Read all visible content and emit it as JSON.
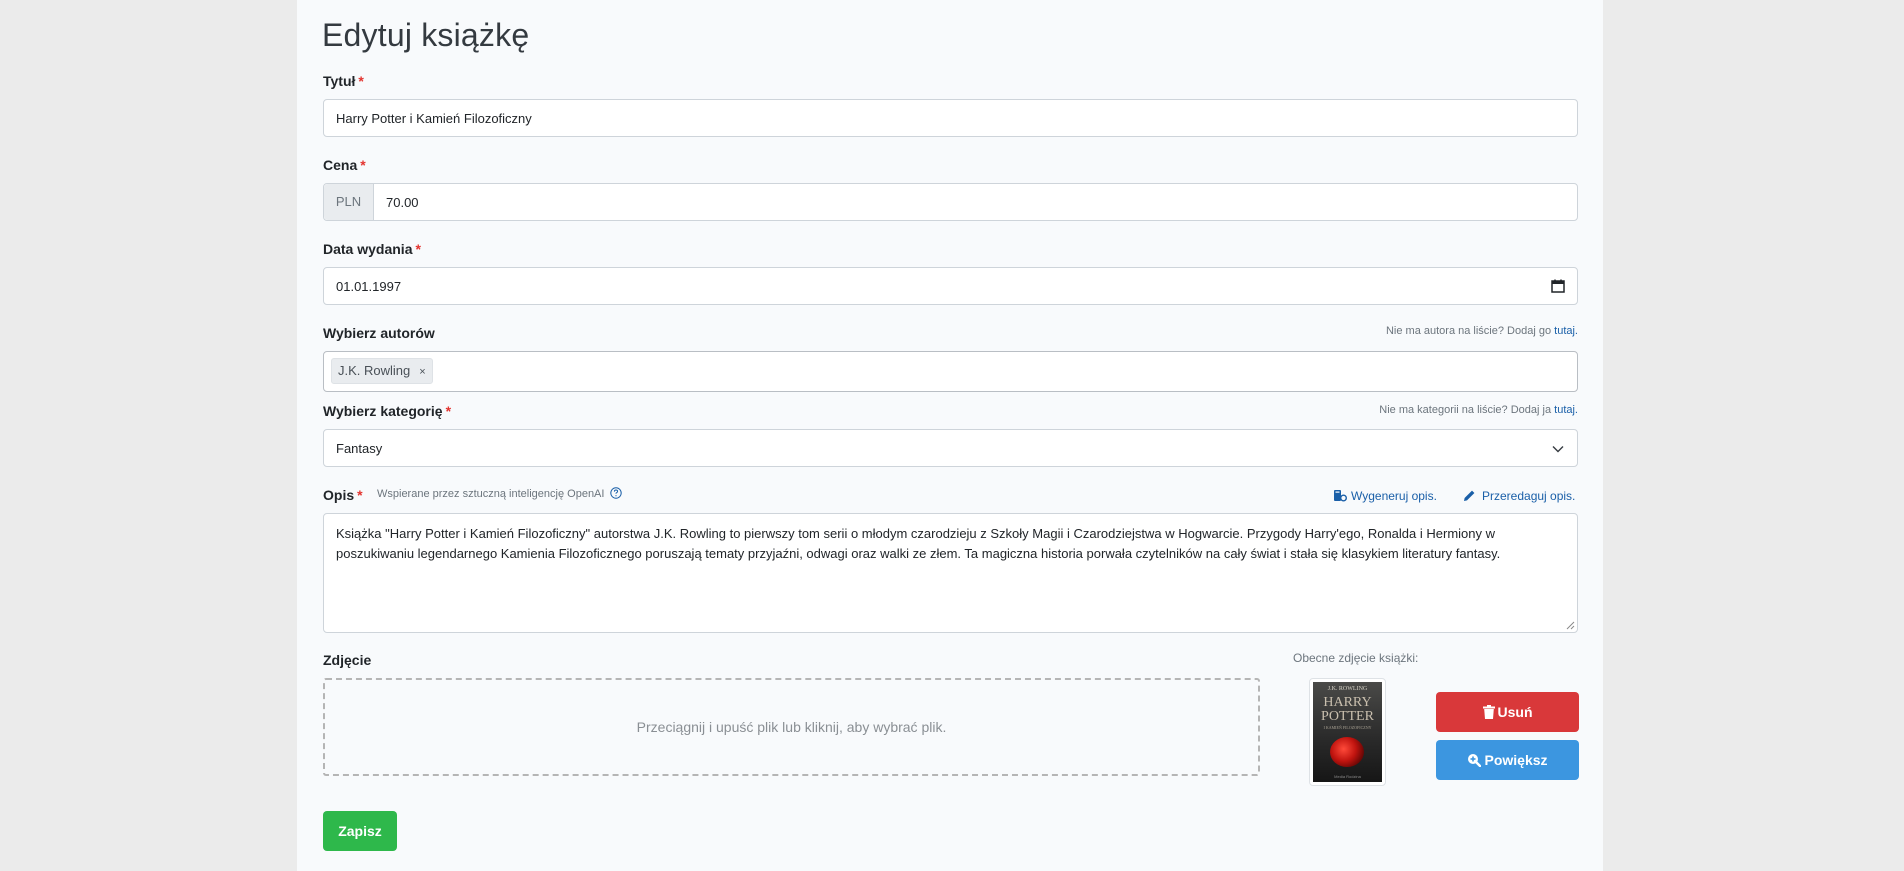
{
  "page": {
    "title": "Edytuj książkę"
  },
  "required_mark": "*",
  "title_field": {
    "label": "Tytuł",
    "value": "Harry Potter i Kamień Filozoficzny"
  },
  "price_field": {
    "label": "Cena",
    "currency": "PLN",
    "value": "70.00"
  },
  "date_field": {
    "label": "Data wydania",
    "value": "01.01.1997",
    "icon": "calendar-icon"
  },
  "authors_field": {
    "label": "Wybierz autorów",
    "hint": "Nie ma autora na liście? Dodaj go",
    "hint_link": "tutaj.",
    "selected": [
      {
        "label": "J.K. Rowling",
        "remove": "×"
      }
    ]
  },
  "category_field": {
    "label": "Wybierz kategorię",
    "hint": "Nie ma kategorii na liście? Dodaj ja",
    "hint_link": "tutaj.",
    "value": "Fantasy",
    "icon": "chevron-down-icon"
  },
  "description_field": {
    "label": "Opis",
    "ai_note": "Wspierane przez sztuczną inteligencję OpenAI",
    "generate_label": "Wygeneruj opis.",
    "edit_label": "Przeredaguj opis.",
    "value": "Książka \"Harry Potter i Kamień Filozoficzny\" autorstwa J.K. Rowling to pierwszy tom serii o młodym czarodzieju z Szkoły Magii i Czarodziejstwa w Hogwarcie. Przygody Harry'ego, Ronalda i Hermiony w poszukiwaniu legendarnego Kamienia Filozoficznego poruszają tematy przyjaźni, odwagi oraz walki ze złem. Ta magiczna historia porwała czytelników na cały świat i stała się klasykiem literatury fantasy."
  },
  "photo_field": {
    "label": "Zdjęcie",
    "dropzone_text": "Przeciągnij i upuść plik lub kliknij, aby wybrać plik.",
    "current_label": "Obecne zdjęcie książki:",
    "cover": {
      "author": "J.K. ROWLING",
      "title_line1": "HARRY",
      "title_line2": "POTTER",
      "subtitle": "I KAMIEŃ FILOZOFICZNY",
      "publisher": "Media Rodzina"
    },
    "delete_label": "Usuń",
    "zoom_label": "Powiększ"
  },
  "save_button": {
    "label": "Zapisz"
  },
  "colors": {
    "danger": "#d9383a",
    "info": "#3c96e0",
    "success": "#2eb84b",
    "link": "#1a5fa8",
    "required": "#e3342f"
  }
}
